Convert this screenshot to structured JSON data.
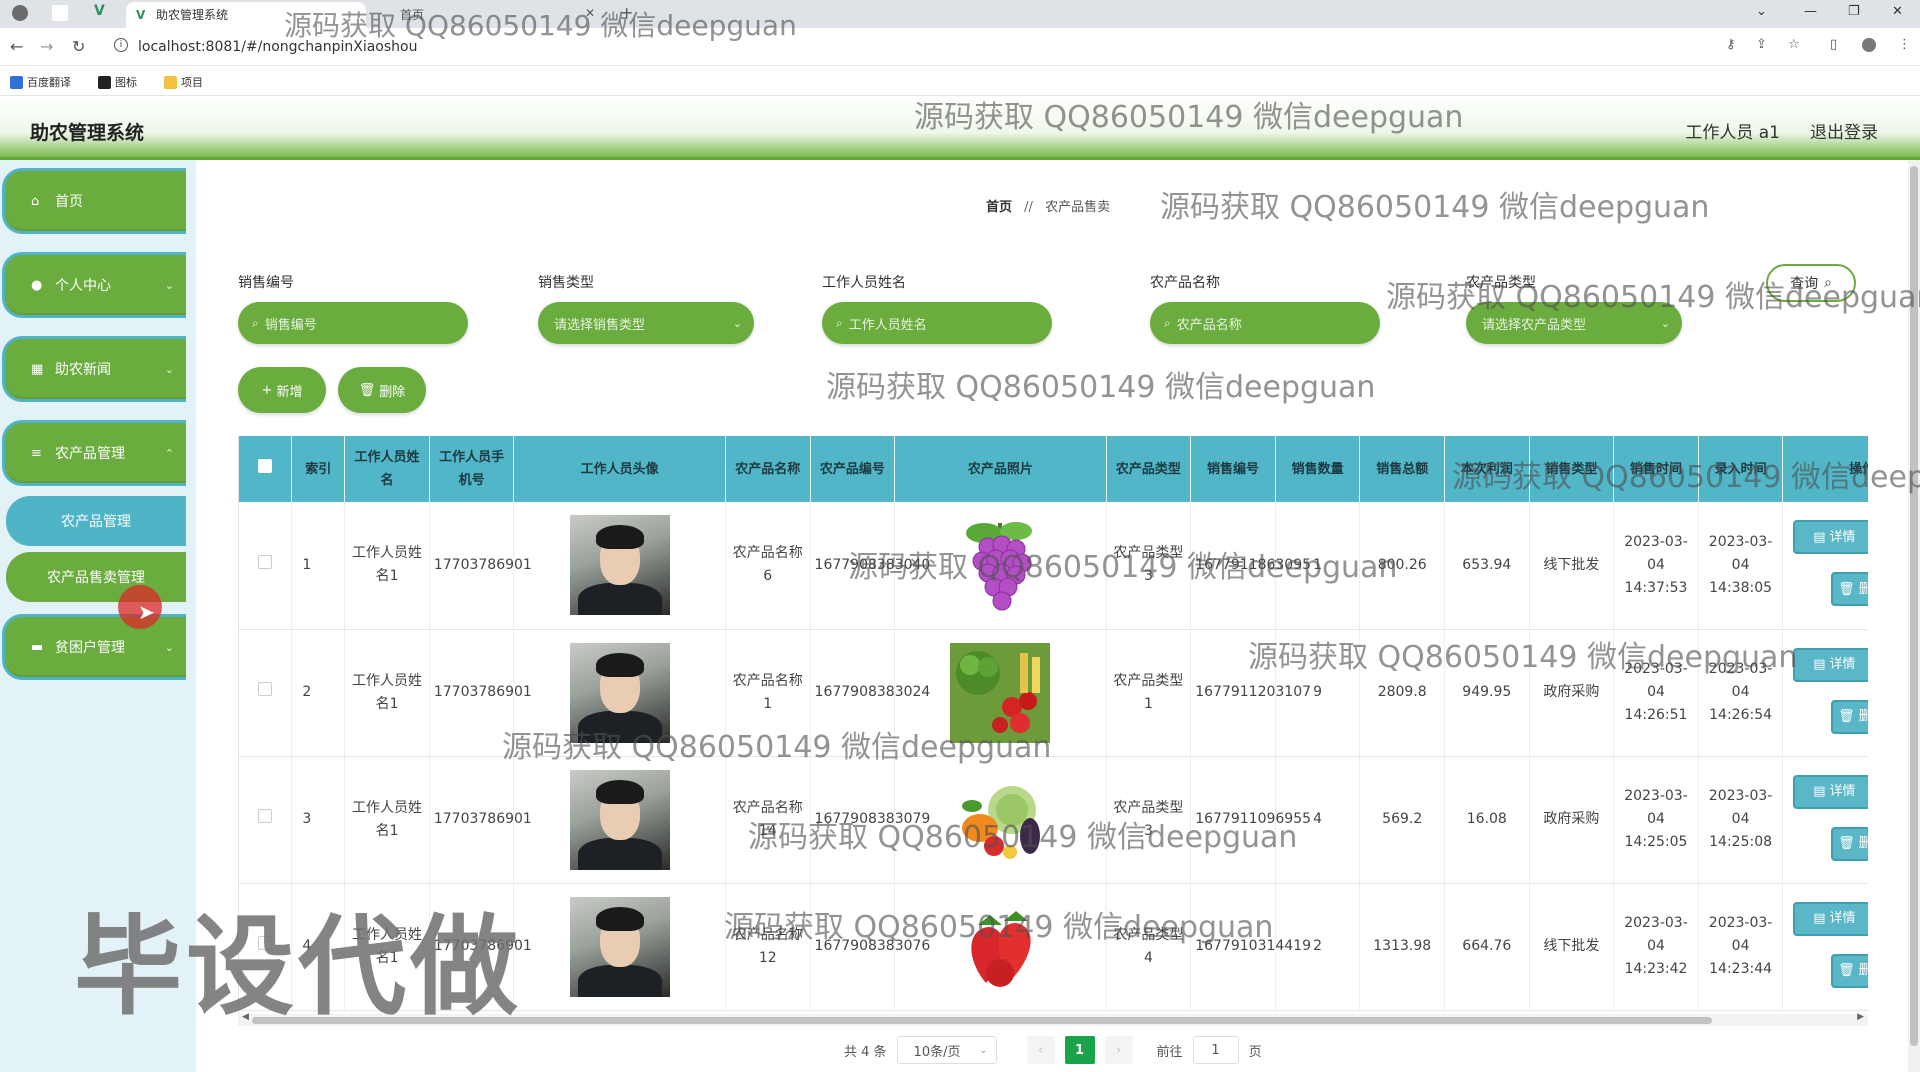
{
  "browser": {
    "tab_active_title": "助农管理系统",
    "tab_second_title": "首页",
    "url": "localhost:8081/#/nongchanpinXiaoshou",
    "bookmarks": [
      "百度翻译",
      "图标",
      "项目"
    ]
  },
  "header": {
    "title": "助农管理系统",
    "user": "工作人员 a1",
    "logout": "退出登录"
  },
  "sidebar": {
    "items": [
      {
        "label": "首页",
        "icon": "home-icon"
      },
      {
        "label": "个人中心",
        "icon": "user-icon"
      },
      {
        "label": "助农新闻",
        "icon": "grid-icon"
      },
      {
        "label": "农产品管理",
        "icon": "list-icon"
      },
      {
        "label": "贫困户管理",
        "icon": "monitor-icon"
      }
    ],
    "subitems": [
      {
        "label": "农产品管理"
      },
      {
        "label": "农产品售卖管理"
      }
    ]
  },
  "breadcrumb": {
    "home": "首页",
    "sep": "//",
    "current": "农产品售卖"
  },
  "filters": [
    {
      "label": "销售编号",
      "placeholder": "销售编号",
      "type": "input"
    },
    {
      "label": "销售类型",
      "placeholder": "请选择销售类型",
      "type": "select"
    },
    {
      "label": "工作人员姓名",
      "placeholder": "工作人员姓名",
      "type": "input"
    },
    {
      "label": "农产品名称",
      "placeholder": "农产品名称",
      "type": "input"
    },
    {
      "label": "农产品类型",
      "placeholder": "请选择农产品类型",
      "type": "select"
    }
  ],
  "query_label": "查询",
  "actions": {
    "add": "新增",
    "delete": "删除"
  },
  "table": {
    "columns": [
      "索引",
      "工作人员姓名",
      "工作人员手机号",
      "工作人员头像",
      "农产品名称",
      "农产品编号",
      "农产品照片",
      "农产品类型",
      "销售编号",
      "销售数量",
      "销售总额",
      "本次利润",
      "销售类型",
      "销售时间",
      "录入时间",
      "操作"
    ],
    "rows": [
      {
        "index": "1",
        "name": "工作人员姓名1",
        "phone": "17703786901",
        "product_name": "农产品名称6",
        "product_no": "1677908383040",
        "product_type": "农产品类型3",
        "sale_no": "1677911863095",
        "qty": "1",
        "total": "800.26",
        "profit": "653.94",
        "sale_type": "线下批发",
        "sale_time": "2023-03-04 14:37:53",
        "entry_time": "2023-03-04 14:38:05",
        "photo": "grapes"
      },
      {
        "index": "2",
        "name": "工作人员姓名1",
        "phone": "17703786901",
        "product_name": "农产品名称1",
        "product_no": "1677908383024",
        "product_type": "农产品类型1",
        "sale_no": "1677911203107",
        "qty": "9",
        "total": "2809.8",
        "profit": "949.95",
        "sale_type": "政府采购",
        "sale_time": "2023-03-04 14:26:51",
        "entry_time": "2023-03-04 14:26:54",
        "photo": "vegetables"
      },
      {
        "index": "3",
        "name": "工作人员姓名1",
        "phone": "17703786901",
        "product_name": "农产品名称14",
        "product_no": "1677908383079",
        "product_type": "农产品类型3",
        "sale_no": "1677911096955",
        "qty": "4",
        "total": "569.2",
        "profit": "16.08",
        "sale_type": "政府采购",
        "sale_time": "2023-03-04 14:25:05",
        "entry_time": "2023-03-04 14:25:08",
        "photo": "veg-mix"
      },
      {
        "index": "4",
        "name": "工作人员姓名1",
        "phone": "17703786901",
        "product_name": "农产品名称12",
        "product_no": "1677908383076",
        "product_type": "农产品类型4",
        "sale_no": "1677910314419",
        "qty": "2",
        "total": "1313.98",
        "profit": "664.76",
        "sale_type": "线下批发",
        "sale_time": "2023-03-04 14:23:42",
        "entry_time": "2023-03-04 14:23:44",
        "photo": "strawberries"
      }
    ],
    "detail_label": "详情",
    "delete_label": "删除"
  },
  "pagination": {
    "total": "共 4 条",
    "page_size": "10条/页",
    "current": "1",
    "goto_prefix": "前往",
    "goto_value": "1",
    "goto_suffix": "页"
  },
  "watermark": "源码获取 QQ86050149 微信deepguan",
  "watermark_big": "毕设代做"
}
